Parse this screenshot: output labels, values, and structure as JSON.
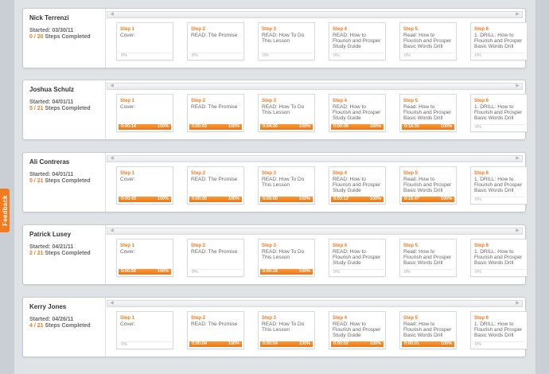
{
  "feedback_label": "Feedback",
  "colors": {
    "accent": "#f47a20",
    "card_bg": "#ffffff",
    "page_bg": "#dfe3e6"
  },
  "users": [
    {
      "name": "Nick Terrenzi",
      "started": "Started: 03/30/11",
      "done": "0",
      "total": "20",
      "steps_label": "Steps Completed",
      "steps": [
        {
          "label": "Step 1",
          "title": "Cover:",
          "time": "",
          "pct": "0%"
        },
        {
          "label": "Step 2",
          "title": "READ: The Promise",
          "time": "",
          "pct": "0%"
        },
        {
          "label": "Step 3",
          "title": "READ: How To Do This Lesson",
          "time": "",
          "pct": "0%"
        },
        {
          "label": "Step 4",
          "title": "READ: How to Flourish and Prosper Study Guide",
          "time": "",
          "pct": "0%"
        },
        {
          "label": "Step 5",
          "title": "Read: How to Flourish and Prosper Basic Words Drill",
          "time": "",
          "pct": "0%"
        },
        {
          "label": "Step 6",
          "title": "1. DRILL: How to Flourish and Prosper Basic Words Drill",
          "time": "",
          "pct": "0%"
        }
      ]
    },
    {
      "name": "Joshua Schulz",
      "started": "Started: 04/01/11",
      "done": "5",
      "total": "21",
      "steps_label": "Steps Completed",
      "steps": [
        {
          "label": "Step 1",
          "title": "Cover:",
          "time": "0:00:14",
          "pct": "100%"
        },
        {
          "label": "Step 2",
          "title": "READ: The Promise",
          "time": "0:00:03",
          "pct": "100%"
        },
        {
          "label": "Step 3",
          "title": "READ: How To Do This Lesson",
          "time": "0:04:20",
          "pct": "100%"
        },
        {
          "label": "Step 4",
          "title": "READ: How to Flourish and Prosper Study Guide",
          "time": "0:00:06",
          "pct": "100%"
        },
        {
          "label": "Step 5",
          "title": "Read: How to Flourish and Prosper Basic Words Drill",
          "time": "0:16:32",
          "pct": "100%"
        },
        {
          "label": "Step 6",
          "title": "1. DRILL: How to Flourish and Prosper Basic Words Drill",
          "time": "",
          "pct": "0%"
        }
      ]
    },
    {
      "name": "Ali Contreras",
      "started": "Started: 04/01/11",
      "done": "5",
      "total": "21",
      "steps_label": "Steps Completed",
      "steps": [
        {
          "label": "Step 1",
          "title": "Cover:",
          "time": "0:00:43",
          "pct": "100%"
        },
        {
          "label": "Step 2",
          "title": "READ: The Promise",
          "time": "0:00:05",
          "pct": "100%"
        },
        {
          "label": "Step 3",
          "title": "READ: How To Do This Lesson",
          "time": "0:09:50",
          "pct": "100%"
        },
        {
          "label": "Step 4",
          "title": "READ: How to Flourish and Prosper Study Guide",
          "time": "0:03:12",
          "pct": "100%"
        },
        {
          "label": "Step 5",
          "title": "Read: How to Flourish and Prosper Basic Words Drill",
          "time": "0:16:47",
          "pct": "100%"
        },
        {
          "label": "Step 6",
          "title": "1. DRILL: How to Flourish and Prosper Basic Words Drill",
          "time": "",
          "pct": "0%"
        }
      ]
    },
    {
      "name": "Patrick Lusey",
      "started": "Started: 04/21/11",
      "done": "2",
      "total": "21",
      "steps_label": "Steps Completed",
      "steps": [
        {
          "label": "Step 1",
          "title": "Cover:",
          "time": "0:00:56",
          "pct": "100%"
        },
        {
          "label": "Step 2",
          "title": "READ: The Promise",
          "time": "",
          "pct": "0%"
        },
        {
          "label": "Step 3",
          "title": "READ: How To Do This Lesson",
          "time": "0:00:18",
          "pct": "100%"
        },
        {
          "label": "Step 4",
          "title": "READ: How to Flourish and Prosper Study Guide",
          "time": "",
          "pct": "0%"
        },
        {
          "label": "Step 5",
          "title": "Read: How to Flourish and Prosper Basic Words Drill",
          "time": "",
          "pct": "0%"
        },
        {
          "label": "Step 6",
          "title": "1. DRILL: How to Flourish and Prosper Basic Words Drill",
          "time": "",
          "pct": "0%"
        }
      ]
    },
    {
      "name": "Kerry Jones",
      "started": "Started: 04/26/11",
      "done": "4",
      "total": "21",
      "steps_label": "Steps Completed",
      "steps": [
        {
          "label": "Step 1",
          "title": "Cover:",
          "time": "",
          "pct": "0%"
        },
        {
          "label": "Step 2",
          "title": "READ: The Promise",
          "time": "0:00:04",
          "pct": "100%"
        },
        {
          "label": "Step 3",
          "title": "READ: How To Do This Lesson",
          "time": "0:00:04",
          "pct": "100%"
        },
        {
          "label": "Step 4",
          "title": "READ: How to Flourish and Prosper Study Guide",
          "time": "0:00:02",
          "pct": "100%"
        },
        {
          "label": "Step 5",
          "title": "Read: How to Flourish and Prosper Basic Words Drill",
          "time": "0:00:01",
          "pct": "100%"
        },
        {
          "label": "Step 6",
          "title": "1. DRILL: How to Flourish and Prosper Basic Words Drill",
          "time": "",
          "pct": "0%"
        }
      ]
    }
  ]
}
